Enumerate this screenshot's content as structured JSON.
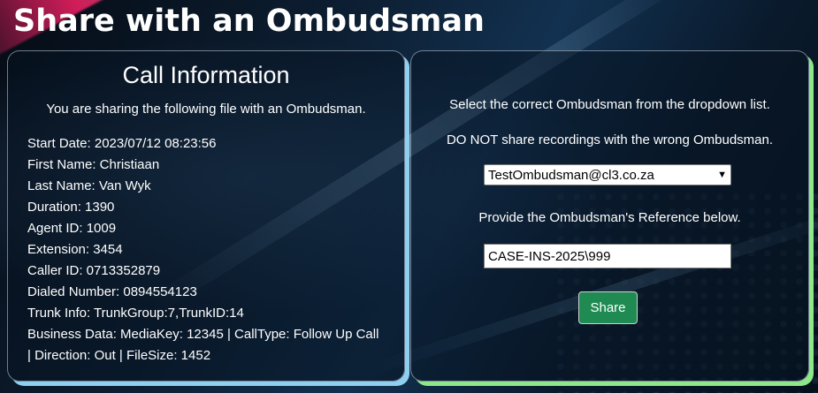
{
  "page": {
    "title": "Share with an Ombudsman"
  },
  "call_info": {
    "heading": "Call Information",
    "subtitle": "You are sharing the following file with an Ombudsman.",
    "rows": [
      "Start Date: 2023/07/12 08:23:56",
      "First Name: Christiaan",
      "Last Name: Van Wyk",
      "Duration: 1390",
      "Agent ID: 1009",
      "Extension: 3454",
      "Caller ID: 0713352879",
      "Dialed Number: 0894554123",
      "Trunk Info: TrunkGroup:7,TrunkID:14",
      "Business Data: MediaKey: 12345 | CallType: Follow Up Call",
      "| Direction: Out | FileSize: 1452"
    ]
  },
  "share_form": {
    "instruction_select": "Select the correct Ombudsman from the dropdown list.",
    "warning": "DO NOT share recordings with the wrong Ombudsman.",
    "ombudsman_selected": "TestOmbudsman@cl3.co.za",
    "instruction_reference": "Provide the Ombudsman's Reference below.",
    "reference_value": "CASE-INS-2025\\999",
    "share_label": "Share"
  },
  "colors": {
    "left_panel_accent": "#8fd0f0",
    "right_panel_accent": "#8ee88a",
    "share_button": "#1f8a52"
  }
}
